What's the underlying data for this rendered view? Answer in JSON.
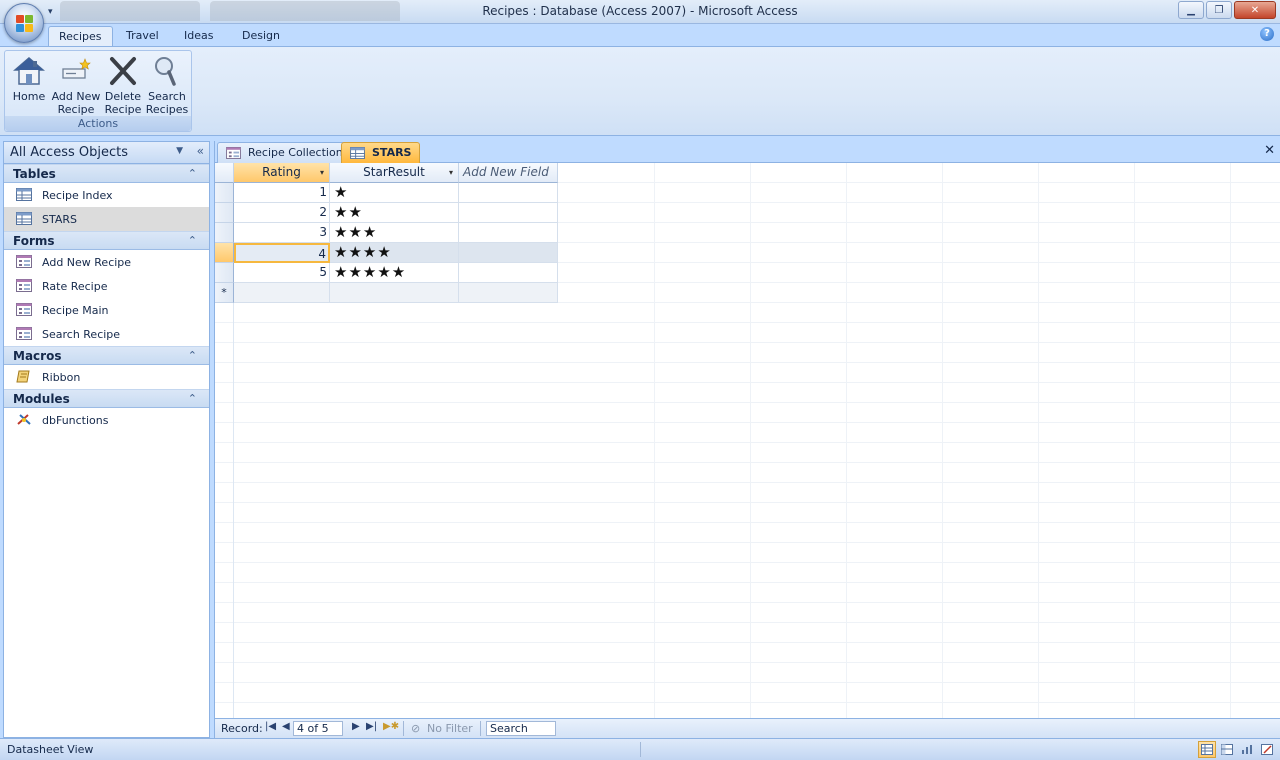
{
  "window": {
    "title": "Recipes : Database (Access 2007)  -  Microsoft Access",
    "controls": [
      "minimize",
      "maximize",
      "close"
    ]
  },
  "ribbon": {
    "tabs": [
      {
        "label": "Recipes",
        "active": true
      },
      {
        "label": "Travel",
        "active": false
      },
      {
        "label": "Ideas",
        "active": false
      },
      {
        "label": "Design",
        "active": false
      }
    ],
    "group": {
      "label": "Actions",
      "buttons": [
        {
          "line1": "Home",
          "line2": "",
          "icon": "home-icon"
        },
        {
          "line1": "Add New",
          "line2": "Recipe",
          "icon": "add-new-recipe-icon"
        },
        {
          "line1": "Delete",
          "line2": "Recipe",
          "icon": "delete-x-icon"
        },
        {
          "line1": "Search",
          "line2": "Recipes",
          "icon": "magnifier-icon"
        }
      ]
    }
  },
  "nav": {
    "title": "All Access Objects",
    "groups": [
      {
        "label": "Tables",
        "items": [
          {
            "label": "Recipe Index",
            "icon": "table-icon",
            "selected": false
          },
          {
            "label": "STARS",
            "icon": "table-icon",
            "selected": true
          }
        ]
      },
      {
        "label": "Forms",
        "items": [
          {
            "label": "Add New Recipe",
            "icon": "form-icon",
            "selected": false
          },
          {
            "label": "Rate Recipe",
            "icon": "form-icon",
            "selected": false
          },
          {
            "label": "Recipe Main",
            "icon": "form-icon",
            "selected": false
          },
          {
            "label": "Search Recipe",
            "icon": "form-icon",
            "selected": false
          }
        ]
      },
      {
        "label": "Macros",
        "items": [
          {
            "label": "Ribbon",
            "icon": "macro-scroll-icon",
            "selected": false
          }
        ]
      },
      {
        "label": "Modules",
        "items": [
          {
            "label": "dbFunctions",
            "icon": "module-icon",
            "selected": false
          }
        ]
      }
    ]
  },
  "document": {
    "tabs": [
      {
        "label": "Recipe Collection",
        "icon": "form-icon",
        "active": false
      },
      {
        "label": "STARS",
        "icon": "table-icon",
        "active": true
      }
    ],
    "datasheet": {
      "columns": [
        "Rating",
        "StarResult",
        "Add New Field"
      ],
      "rows": [
        {
          "rating": "1",
          "stars": "★"
        },
        {
          "rating": "2",
          "stars": "★★"
        },
        {
          "rating": "3",
          "stars": "★★★"
        },
        {
          "rating": "4",
          "stars": "★★★★"
        },
        {
          "rating": "5",
          "stars": "★★★★★"
        }
      ],
      "current_row_index": 3,
      "new_row_marker": "*"
    },
    "record_nav": {
      "label": "Record:",
      "position": "4 of 5",
      "filter": "No Filter",
      "search": "Search"
    }
  },
  "status": {
    "text": "Datasheet View"
  },
  "colors": {
    "accent": "#ffc86b",
    "frame": "#bfdbff",
    "border": "#8db2e3"
  }
}
